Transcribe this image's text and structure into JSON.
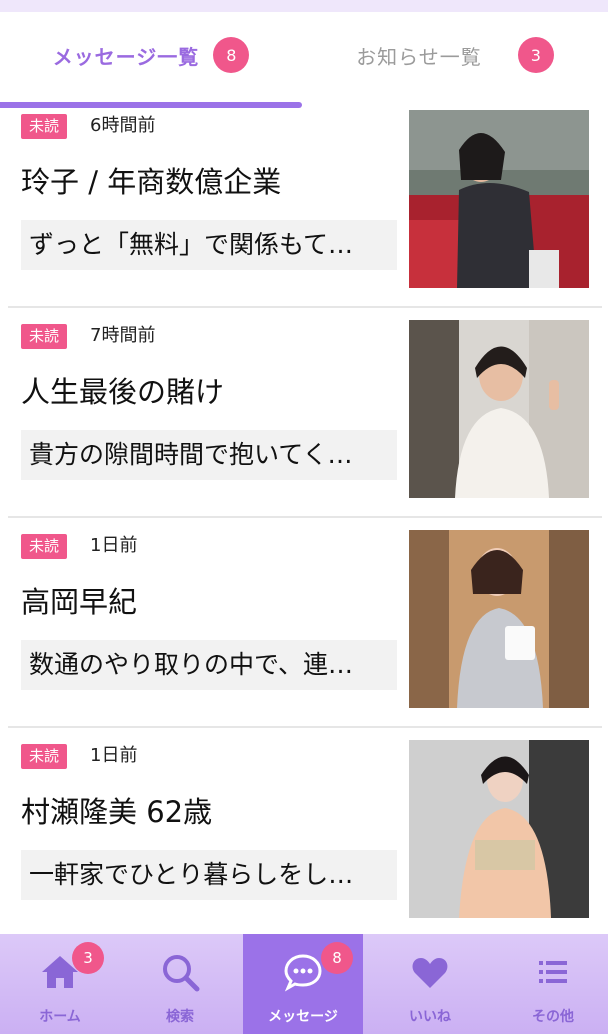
{
  "tabs": {
    "messages": {
      "label": "メッセージ一覧",
      "badge": "8"
    },
    "notices": {
      "label": "お知らせ一覧",
      "badge": "3"
    }
  },
  "messages": [
    {
      "status": "未読",
      "time": "6時間前",
      "name": "玲子 / 年商数億企業",
      "preview": "ずっと「無料」で関係もて…",
      "photo": "woman-in-car-photo"
    },
    {
      "status": "未読",
      "time": "7時間前",
      "name": "人生最後の賭け",
      "preview": "貴方の隙間時間で抱いてく…",
      "photo": "woman-peace-sign-photo"
    },
    {
      "status": "未読",
      "time": "1日前",
      "name": "高岡早紀",
      "preview": "数通のやり取りの中で、連…",
      "photo": "woman-with-mug-photo"
    },
    {
      "status": "未読",
      "time": "1日前",
      "name": "村瀬隆美 62歳",
      "preview": "一軒家でひとり暮らしをし…",
      "photo": "woman-in-kimono-photo"
    }
  ],
  "nav": {
    "home": {
      "label": "ホーム",
      "badge": "3",
      "icon": "home-icon"
    },
    "search": {
      "label": "検索",
      "icon": "search-icon"
    },
    "message": {
      "label": "メッセージ",
      "badge": "8",
      "icon": "chat-bubble-icon"
    },
    "likes": {
      "label": "いいね",
      "icon": "heart-icon"
    },
    "other": {
      "label": "その他",
      "icon": "list-icon"
    }
  },
  "colors": {
    "accent": "#9b72e8",
    "badge": "#f0578b",
    "nav_bg": "#d6c1f6"
  }
}
